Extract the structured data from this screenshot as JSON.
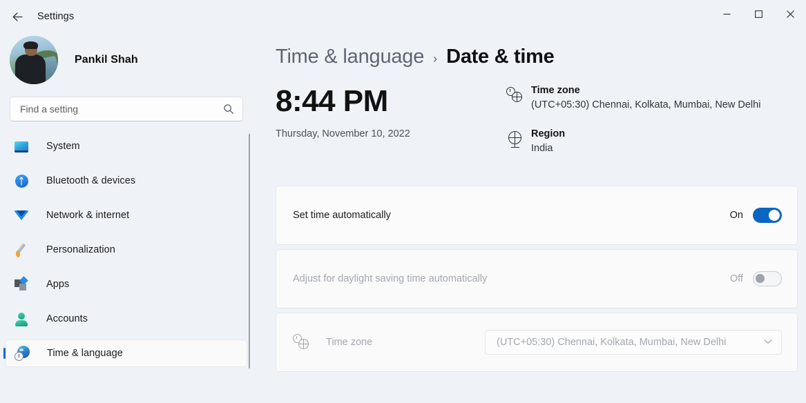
{
  "titlebar": {
    "back_label": "back-arrow",
    "app_title": "Settings",
    "minimize": "─",
    "maximize": "□",
    "close": "✕"
  },
  "sidebar": {
    "profile": {
      "name": "Pankil Shah"
    },
    "search": {
      "placeholder": "Find a setting",
      "value": ""
    },
    "items": [
      {
        "label": "System",
        "icon": "monitor-icon",
        "active": false
      },
      {
        "label": "Bluetooth & devices",
        "icon": "bluetooth-icon",
        "active": false
      },
      {
        "label": "Network & internet",
        "icon": "wifi-icon",
        "active": false
      },
      {
        "label": "Personalization",
        "icon": "paintbrush-icon",
        "active": false
      },
      {
        "label": "Apps",
        "icon": "apps-icon",
        "active": false
      },
      {
        "label": "Accounts",
        "icon": "person-icon",
        "active": false
      },
      {
        "label": "Time & language",
        "icon": "time-language-icon",
        "active": true
      }
    ]
  },
  "main": {
    "breadcrumb": {
      "parent": "Time & language",
      "separator": "›",
      "current": "Date & time"
    },
    "clock": {
      "time": "8:44 PM",
      "date": "Thursday, November 10, 2022"
    },
    "meta": [
      {
        "title": "Time zone",
        "value": "(UTC+05:30) Chennai, Kolkata, Mumbai, New Delhi",
        "icon": "time-zone-globe-icon"
      },
      {
        "title": "Region",
        "value": "India",
        "icon": "globe-icon"
      }
    ],
    "cards": [
      {
        "label": "Set time automatically",
        "state_label": "On",
        "toggle": "on",
        "disabled": false
      },
      {
        "label": "Adjust for daylight saving time automatically",
        "state_label": "Off",
        "toggle": "off",
        "disabled": true
      },
      {
        "label": "Time zone",
        "select_value": "(UTC+05:30) Chennai, Kolkata, Mumbai, New Delhi",
        "chevron": "⌄",
        "disabled": true,
        "icon": "time-zone-globe-icon"
      }
    ]
  },
  "colors": {
    "accent": "#0a66c2",
    "window_bg": "#eff3f8",
    "card_bg": "#fbfbfb",
    "nav_active_pill": "#0f6cbd"
  }
}
